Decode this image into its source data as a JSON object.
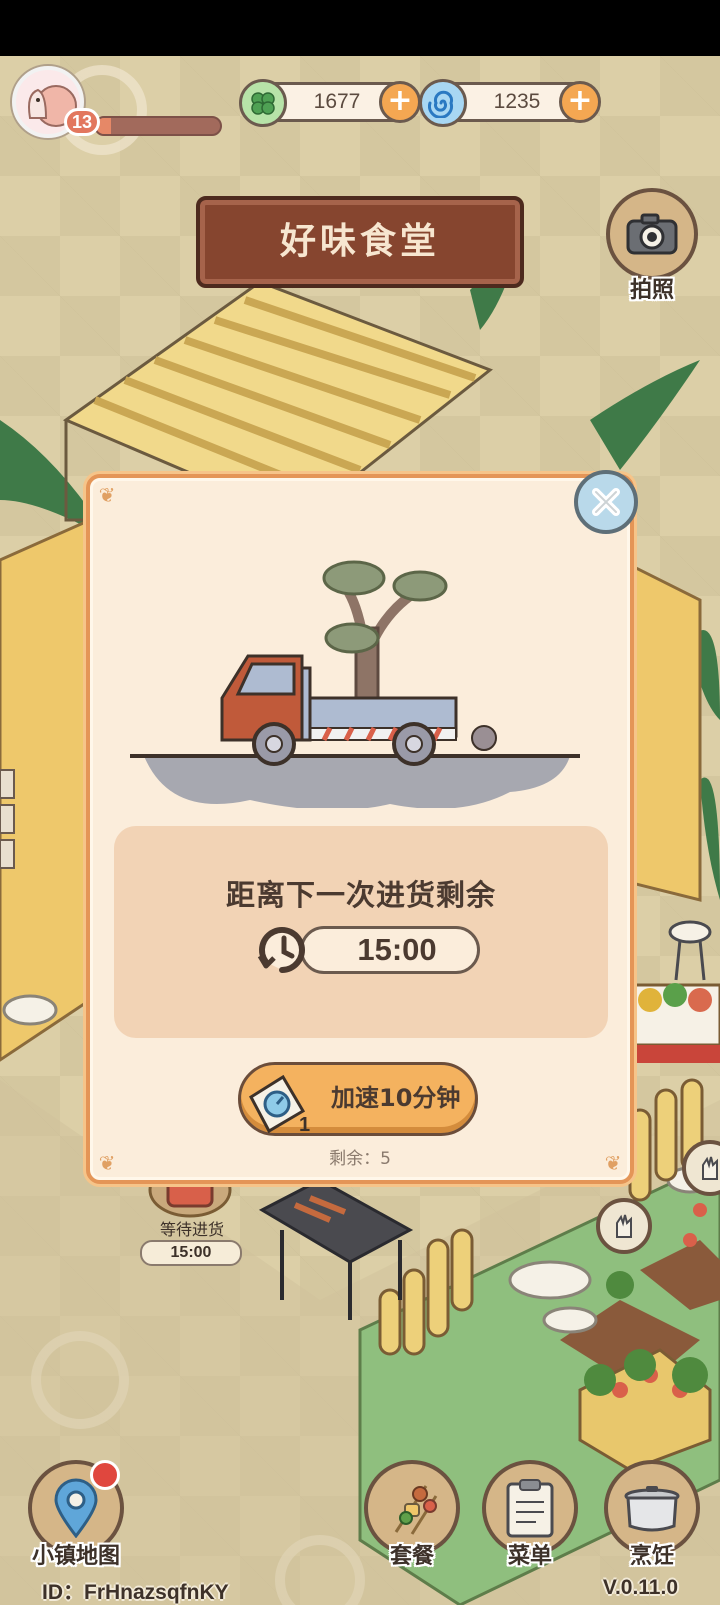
{
  "hud": {
    "level": "13",
    "xp_fraction": 0.12,
    "leaf_currency": "1677",
    "swirl_currency": "1235"
  },
  "restaurant": {
    "title": "好味食堂"
  },
  "side_buttons": {
    "photo_label": "拍照"
  },
  "scene": {
    "waiting_label": "等待进货",
    "waiting_timer": "15:00"
  },
  "dialog": {
    "info_title": "距离下一次进货剩余",
    "timer": "15:00",
    "speed_up_label": "加速10分钟",
    "speed_up_item_count": "1",
    "remaining_text": "剩余：5"
  },
  "bottom_nav": {
    "map_label": "小镇地图",
    "set_meal_label": "套餐",
    "menu_label": "菜单",
    "cook_label": "烹饪"
  },
  "footer": {
    "player_id": "ID：FrHnazsqfnKY",
    "version": "V.0.11.0"
  },
  "colors": {
    "dialog_bg": "#fbeddb",
    "dialog_border": "#e49557",
    "button_orange": "#f4b25f",
    "sign_brown": "#86452f"
  }
}
